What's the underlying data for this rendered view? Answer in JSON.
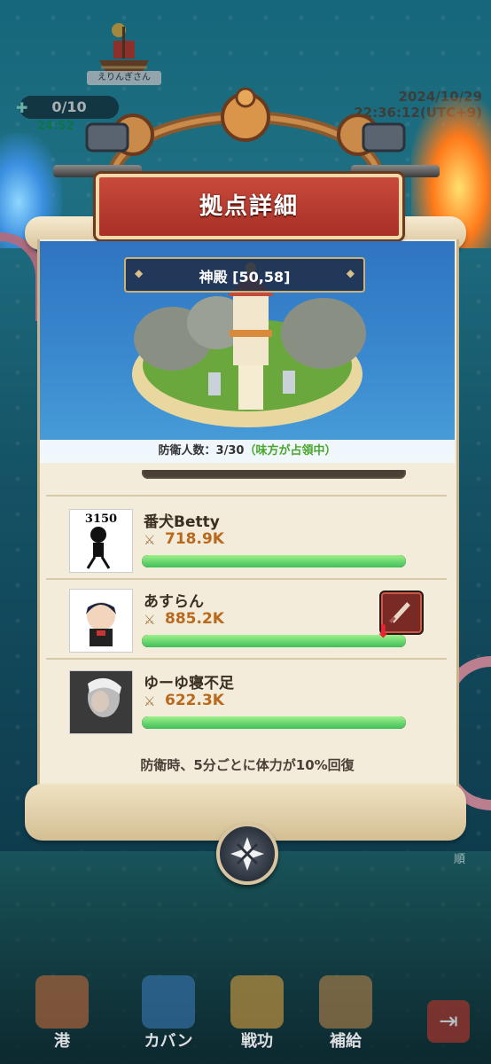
{
  "hud": {
    "player_name": "えりんぎさん",
    "counter": "0/10",
    "timer": "24:52",
    "date": "2024/10/29",
    "time": "22:36:12(UTC+9)"
  },
  "dialog": {
    "title": "拠点詳細",
    "location": "神殿 [50,58]",
    "defense_label": "防衛人数：3/30",
    "defense_status": "（味方が占領中）",
    "regen_text": "防衛時、5分ごとに体力が10%回復"
  },
  "defenders": [
    {
      "name": "番犬Betty",
      "power": "718.9K",
      "hp_fraction": 1.0,
      "avatar_text": "3150"
    },
    {
      "name": "あすらん",
      "power": "885.2K",
      "hp_fraction": 1.0
    },
    {
      "name": "ゆーゆ寝不足",
      "power": "622.3K",
      "hp_fraction": 1.0
    }
  ],
  "nav": {
    "items": [
      {
        "label": "港"
      },
      {
        "label": "カバン"
      },
      {
        "label": "戦功"
      },
      {
        "label": "補給"
      }
    ],
    "side_label": "順"
  },
  "colors": {
    "banner": "#a82f27",
    "power": "#b8691e",
    "hp": "#3fbf58",
    "status_green": "#4aa62a"
  }
}
